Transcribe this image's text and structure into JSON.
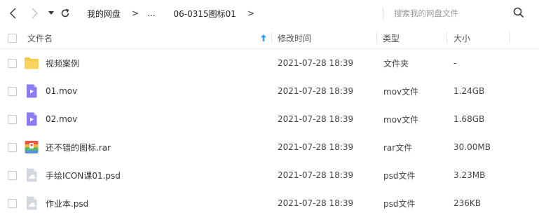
{
  "toolbar": {
    "back_icon": "chevron-left-icon",
    "forward_icon": "chevron-right-icon",
    "dropdown_icon": "caret-down-icon",
    "refresh_icon": "refresh-icon"
  },
  "breadcrumb": {
    "root": "我的网盘",
    "sep1": ">",
    "ellipsis": "...",
    "current": "06-0315图标01",
    "sep2": ">"
  },
  "search": {
    "placeholder": "搜索我的网盘文件",
    "icon": "search-icon"
  },
  "table": {
    "headers": {
      "name": "文件名",
      "modified": "修改时间",
      "type": "类型",
      "size": "大小"
    },
    "sort": {
      "column": "name",
      "direction": "ascending"
    },
    "rows": [
      {
        "name": "视频案例",
        "modified": "2021-07-28 18:39",
        "type": "文件夹",
        "size": "-",
        "icon": "folder-icon"
      },
      {
        "name": "01.mov",
        "modified": "2021-07-28 18:39",
        "type": "mov文件",
        "size": "1.24GB",
        "icon": "video-file-icon"
      },
      {
        "name": "02.mov",
        "modified": "2021-07-28 18:39",
        "type": "mov文件",
        "size": "1.68GB",
        "icon": "video-file-icon"
      },
      {
        "name": "还不错的图标.rar",
        "modified": "2021-07-28 18:39",
        "type": "rar文件",
        "size": "30.00MB",
        "icon": "archive-file-icon"
      },
      {
        "name": "手绘ICON课01.psd",
        "modified": "2021-07-28 18:39",
        "type": "psd文件",
        "size": "3.23MB",
        "icon": "image-file-icon"
      },
      {
        "name": "作业本.psd",
        "modified": "2021-07-28 18:39",
        "type": "psd文件",
        "size": "236KB",
        "icon": "image-file-icon"
      }
    ]
  },
  "colors": {
    "folder": "#f7c94b",
    "video": "#8a7cf0",
    "sort_arrow": "#2d9ee8",
    "psd": "#d4d8de"
  }
}
